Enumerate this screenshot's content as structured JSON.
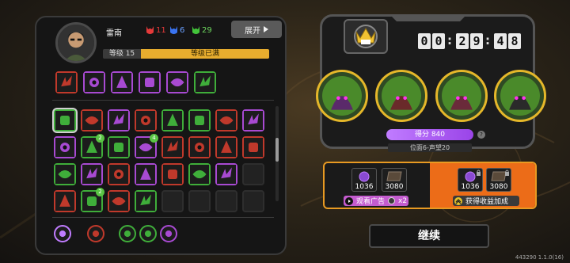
{
  "player": {
    "name": "雷南",
    "avatar_icon": "player-portrait-icon"
  },
  "resources": [
    {
      "icon": "red-horned-demon-icon",
      "color": "#e53a3a",
      "value": "11"
    },
    {
      "icon": "blue-horned-demon-icon",
      "color": "#3a74f0",
      "value": "6"
    },
    {
      "icon": "green-horned-demon-icon",
      "color": "#43c43a",
      "value": "29"
    }
  ],
  "expand_button": {
    "label": "展开",
    "icon": "chevron-right-icon"
  },
  "level": {
    "label": "等级 15",
    "status": "等级已满",
    "progress": 1.0
  },
  "equipped_row": [
    {
      "icon": "claw-slash-icon",
      "color": "#c0392b"
    },
    {
      "icon": "treasure-chest-icon",
      "color": "#a84ad2"
    },
    {
      "icon": "bear-head-icon",
      "color": "#a84ad2"
    },
    {
      "icon": "banner-flag-icon",
      "color": "#a84ad2"
    },
    {
      "icon": "backpack-icon",
      "color": "#a84ad2"
    },
    {
      "icon": "swirl-rune-icon",
      "color": "#3fae3a"
    }
  ],
  "skills": [
    {
      "icon": "wind-dash-icon",
      "color": "#3fae3a",
      "selected": true
    },
    {
      "icon": "triple-claw-icon",
      "color": "#c0392b"
    },
    {
      "icon": "tower-icon",
      "color": "#a84ad2"
    },
    {
      "icon": "fire-spear-icon",
      "color": "#c0392b"
    },
    {
      "icon": "green-heart-icon",
      "color": "#3fae3a"
    },
    {
      "icon": "medical-cross-icon",
      "color": "#3fae3a"
    },
    {
      "icon": "dragon-breath-icon",
      "color": "#c0392b"
    },
    {
      "icon": "lightning-arrows-icon",
      "color": "#a84ad2"
    },
    {
      "icon": "red-trap-icon",
      "color": "#a84ad2"
    },
    {
      "icon": "poison-strike-icon",
      "color": "#3fae3a",
      "badge": "2"
    },
    {
      "icon": "shield-check-icon",
      "color": "#3fae3a"
    },
    {
      "icon": "gear-core-icon",
      "color": "#a84ad2",
      "badge": "4"
    },
    {
      "icon": "spiral-vortex-icon",
      "color": "#c0392b"
    },
    {
      "icon": "owl-mask-icon",
      "color": "#c0392b"
    },
    {
      "icon": "crimson-claws-icon",
      "color": "#c0392b"
    },
    {
      "icon": "red-arrows-icon",
      "color": "#c0392b"
    },
    {
      "icon": "purple-fist-icon",
      "color": "#3fae3a"
    },
    {
      "icon": "blue-spear-icon",
      "color": "#a84ad2"
    },
    {
      "icon": "orange-shards-icon",
      "color": "#c0392b"
    },
    {
      "icon": "ladder-icon",
      "color": "#a84ad2"
    },
    {
      "icon": "twin-blades-icon",
      "color": "#c0392b"
    },
    {
      "icon": "purple-crystals-icon",
      "color": "#3fae3a"
    },
    {
      "icon": "dark-brush-icon",
      "color": "#a84ad2"
    },
    {
      "icon": "empty-slot",
      "color": "#2a2a2a"
    },
    {
      "icon": "flame-wall-icon",
      "color": "#c0392b"
    },
    {
      "icon": "green-sprout-icon",
      "color": "#3fae3a",
      "badge": "2"
    },
    {
      "icon": "red-scratch-icon",
      "color": "#c0392b"
    },
    {
      "icon": "grass-blades-icon",
      "color": "#3fae3a"
    },
    {
      "icon": "empty-slot",
      "color": "#2a2a2a"
    },
    {
      "icon": "empty-slot",
      "color": "#2a2a2a"
    },
    {
      "icon": "empty-slot",
      "color": "#2a2a2a"
    },
    {
      "icon": "empty-slot",
      "color": "#2a2a2a"
    }
  ],
  "bottom_items": [
    {
      "icon": "purple-chest-token-icon",
      "color": "#c07cff"
    },
    {
      "icon": "red-claw-token-icon",
      "color": "#c0392b"
    },
    {
      "icon": "green-orb-token-icon",
      "color": "#3fae3a"
    },
    {
      "icon": "green-flask-token-icon",
      "color": "#3fae3a"
    },
    {
      "icon": "purple-orb-token-icon",
      "color": "#a84ad2"
    }
  ],
  "timer": {
    "digits": [
      "0",
      "0",
      "2",
      "9",
      "4",
      "8"
    ],
    "crown_icon": "crown-emblem-icon"
  },
  "team": [
    {
      "icon": "dark-demon-member-icon"
    },
    {
      "icon": "horned-mask-member-icon"
    },
    {
      "icon": "red-creature-member-icon"
    },
    {
      "icon": "glasses-boy-member-icon"
    }
  ],
  "score": {
    "label": "得分 840",
    "help_icon": "question-icon"
  },
  "rank": {
    "label": "位面6-声望20"
  },
  "rewards": {
    "base": [
      {
        "icon": "purple-orb-currency-icon",
        "value": "1036"
      },
      {
        "icon": "wood-plank-currency-icon",
        "value": "3080"
      }
    ],
    "boosted": [
      {
        "icon": "purple-orb-currency-icon",
        "value": "1036",
        "locked": true
      },
      {
        "icon": "wood-plank-currency-icon",
        "value": "3080",
        "locked": true
      }
    ],
    "watch_ad": {
      "label": "观看广告",
      "multiplier": "x2",
      "icon": "play-video-icon"
    },
    "boost": {
      "label": "获得收益加成",
      "icon": "double-chevron-up-icon"
    }
  },
  "continue_button": {
    "label": "继续"
  },
  "version": "443290 1.1.0(16)"
}
